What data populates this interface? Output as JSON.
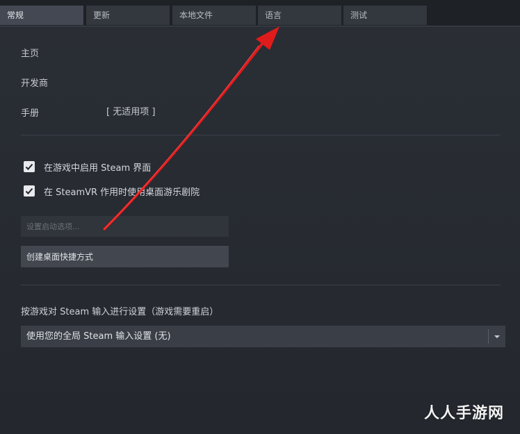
{
  "tabs": [
    {
      "label": "常规",
      "active": true
    },
    {
      "label": "更新",
      "active": false
    },
    {
      "label": "本地文件",
      "active": false
    },
    {
      "label": "语言",
      "active": false
    },
    {
      "label": "测试",
      "active": false
    }
  ],
  "info": {
    "homepage_label": "主页",
    "developer_label": "开发商",
    "manual_label": "手册",
    "manual_value": "[ 无适用项 ]"
  },
  "options": {
    "overlay_label": "在游戏中启用 Steam 界面",
    "overlay_checked": true,
    "vr_theater_label": "在 SteamVR 作用时使用桌面游乐剧院",
    "vr_theater_checked": true
  },
  "launch": {
    "placeholder": "设置启动选项..."
  },
  "shortcut": {
    "label": "创建桌面快捷方式"
  },
  "input_settings": {
    "label": "按游戏对 Steam 输入进行设置（游戏需要重启）",
    "selected": "使用您的全局 Steam 输入设置 (无)"
  },
  "watermark": "人人手游网",
  "colors": {
    "background": "#262a31",
    "tab_active": "#434852",
    "tab_inactive": "#33373e",
    "annotation_arrow": "#e01b1b"
  },
  "icons": {
    "checkbox": "check-icon",
    "dropdown": "chevron-down-icon",
    "annotation": "red-arrow-icon"
  }
}
